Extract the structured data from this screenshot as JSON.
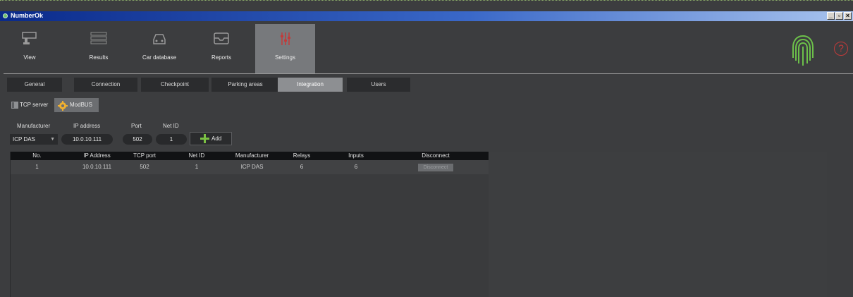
{
  "window": {
    "title": "NumberOk",
    "buttons": [
      "_",
      "▫",
      "×"
    ]
  },
  "toolbar": {
    "items": [
      {
        "label": "View",
        "icon": "camera-icon"
      },
      {
        "label": "Results",
        "icon": "results-icon"
      },
      {
        "label": "Car database",
        "icon": "car-icon"
      },
      {
        "label": "Reports",
        "icon": "inbox-icon"
      },
      {
        "label": "Settings",
        "icon": "settings-sliders-icon",
        "active": true
      }
    ]
  },
  "help_label": "?",
  "tabs": [
    {
      "label": "General"
    },
    {
      "label": "Connection"
    },
    {
      "label": "Checkpoint"
    },
    {
      "label": "Parking areas"
    },
    {
      "label": "Integration",
      "active": true
    },
    {
      "label": "Users"
    }
  ],
  "subtabs": [
    {
      "label": "TCP server"
    },
    {
      "label": "ModBUS",
      "active": true
    }
  ],
  "form": {
    "manufacturer_label": "Manufacturer",
    "ip_label": "IP address",
    "port_label": "Port",
    "netid_label": "Net ID",
    "manufacturer_value": "ICP DAS",
    "ip_value": "10.0.10.111",
    "port_value": "502",
    "netid_value": "1",
    "add_label": "Add"
  },
  "table": {
    "columns": [
      "No.",
      "IP Address",
      "TCP port",
      "Net ID",
      "Manufacturer",
      "Relays",
      "Inputs",
      "Disconnect"
    ],
    "rows": [
      {
        "no": "1",
        "ip": "10.0.10.111",
        "port": "502",
        "netid": "1",
        "manufacturer": "ICP DAS",
        "relays": "6",
        "inputs": "6",
        "disconnect": "Disconnect"
      }
    ]
  },
  "colors": {
    "accent_red": "#c23a3a",
    "fingerprint_green": "#6cc04a",
    "titlebar_blue": "#0a2a8a"
  }
}
